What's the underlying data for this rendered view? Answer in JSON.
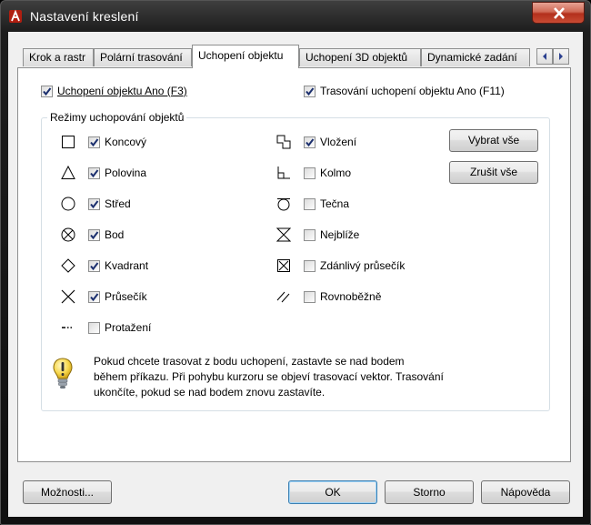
{
  "window": {
    "title": "Nastavení kreslení",
    "close_icon": "close-icon",
    "app_icon": "autocad-app-icon"
  },
  "tabs": [
    {
      "label": "Krok a rastr",
      "active": false
    },
    {
      "label": "Polární trasování",
      "active": false
    },
    {
      "label": "Uchopení objektu",
      "active": true
    },
    {
      "label": "Uchopení 3D objektů",
      "active": false
    },
    {
      "label": "Dynamické zadání",
      "active": false
    }
  ],
  "tab_scroll": {
    "left_icon": "arrow-left-icon",
    "right_icon": "arrow-right-icon"
  },
  "osnap_on": {
    "label": "Uchopení objektu Ano (F3)",
    "checked": true
  },
  "otrack_on": {
    "label": "Trasování uchopení objektu Ano (F11)",
    "checked": true
  },
  "modes_group": {
    "title": "Režimy uchopování objektů",
    "left_modes": [
      {
        "label": "Koncový",
        "checked": true,
        "icon": "endpoint-marker-icon"
      },
      {
        "label": "Polovina",
        "checked": true,
        "icon": "midpoint-marker-icon"
      },
      {
        "label": "Střed",
        "checked": true,
        "icon": "center-marker-icon"
      },
      {
        "label": "Bod",
        "checked": true,
        "icon": "node-marker-icon"
      },
      {
        "label": "Kvadrant",
        "checked": true,
        "icon": "quadrant-marker-icon"
      },
      {
        "label": "Průsečík",
        "checked": true,
        "icon": "intersection-marker-icon"
      },
      {
        "label": "Protažení",
        "checked": false,
        "icon": "extension-marker-icon"
      }
    ],
    "right_modes": [
      {
        "label": "Vložení",
        "checked": true,
        "icon": "insertion-marker-icon"
      },
      {
        "label": "Kolmo",
        "checked": false,
        "icon": "perpendicular-marker-icon"
      },
      {
        "label": "Tečna",
        "checked": false,
        "icon": "tangent-marker-icon"
      },
      {
        "label": "Nejblíže",
        "checked": false,
        "icon": "nearest-marker-icon"
      },
      {
        "label": "Zdánlivý průsečík",
        "checked": false,
        "icon": "apparent-intersection-marker-icon"
      },
      {
        "label": "Rovnoběžně",
        "checked": false,
        "icon": "parallel-marker-icon"
      }
    ],
    "select_all": "Vybrat vše",
    "clear_all": "Zrušit vše",
    "info_icon": "lightbulb-info-icon",
    "info_text": [
      "Pokud chcete trasovat z bodu uchopení, zastavte se nad bodem",
      "během příkazu. Při pohybu kurzoru se objeví trasovací vektor. Trasování",
      "ukončíte, pokud se nad bodem znovu zastavíte."
    ]
  },
  "footer": {
    "options": "Možnosti...",
    "ok": "OK",
    "cancel": "Storno",
    "help": "Nápověda"
  }
}
